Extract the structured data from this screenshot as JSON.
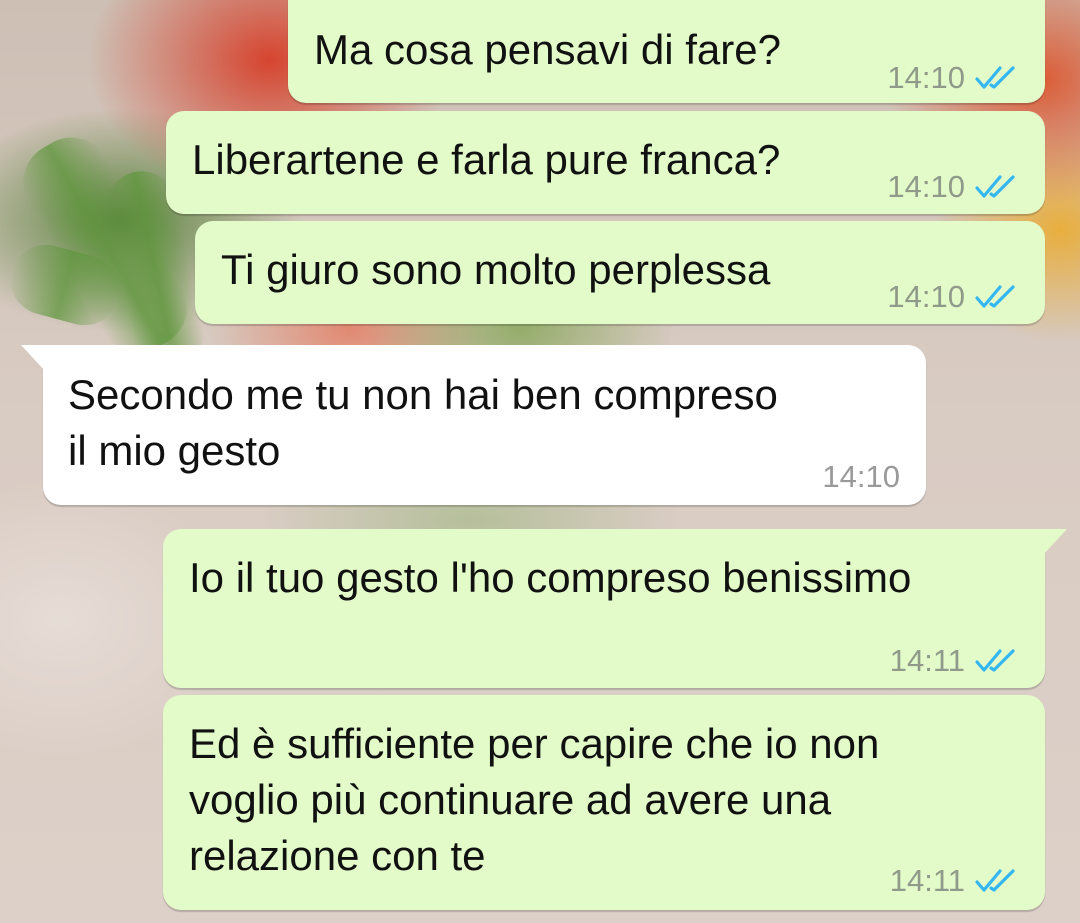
{
  "chat": {
    "messages": [
      {
        "direction": "outgoing",
        "lines": [
          "Ma cosa pensavi di fare?"
        ],
        "time": "14:10",
        "status_icon": "double-check-read-icon"
      },
      {
        "direction": "outgoing",
        "lines": [
          "Liberartene e farla pure franca?"
        ],
        "time": "14:10",
        "status_icon": "double-check-read-icon"
      },
      {
        "direction": "outgoing",
        "lines": [
          "Ti giuro sono molto perplessa"
        ],
        "time": "14:10",
        "status_icon": "double-check-read-icon"
      },
      {
        "direction": "incoming",
        "lines": [
          "Secondo me tu non hai ben compreso",
          "il mio gesto"
        ],
        "time": "14:10"
      },
      {
        "direction": "outgoing",
        "lines": [
          "Io il tuo gesto l'ho compreso benissimo"
        ],
        "time": "14:11",
        "status_icon": "double-check-read-icon"
      },
      {
        "direction": "outgoing",
        "lines": [
          "Ed è sufficiente per capire che io non",
          "voglio più continuare ad avere una",
          "relazione con te"
        ],
        "time": "14:11",
        "status_icon": "double-check-read-icon"
      }
    ]
  },
  "colors": {
    "outgoing_bubble": "#e2fbc8",
    "incoming_bubble": "#ffffff",
    "read_ticks": "#34b7f1",
    "timestamp": "#8f9a8a"
  }
}
